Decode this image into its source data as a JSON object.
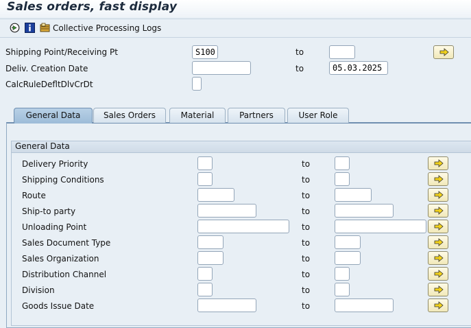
{
  "header": {
    "title": "Sales orders, fast display"
  },
  "toolbar": {
    "execute_icon": "execute-clock-icon",
    "info_icon": "info-icon",
    "logs_icon": "logs-icon",
    "logs_label": "Collective Processing Logs"
  },
  "selection": {
    "to_label": "to",
    "rows": [
      {
        "label": "Shipping Point/Receiving Pt",
        "from": "S100",
        "to": ""
      },
      {
        "label": "Deliv. Creation Date",
        "from": "",
        "to": "05.03.2025"
      },
      {
        "label": "CalcRuleDefltDlvCrDt"
      }
    ]
  },
  "tabs": [
    {
      "label": "General Data",
      "active": true
    },
    {
      "label": "Sales Orders"
    },
    {
      "label": "Material"
    },
    {
      "label": "Partners"
    },
    {
      "label": "User Role"
    }
  ],
  "general": {
    "title": "General Data",
    "rows": [
      {
        "label": "Delivery Priority",
        "from": "",
        "to": ""
      },
      {
        "label": "Shipping Conditions",
        "from": "",
        "to": ""
      },
      {
        "label": "Route",
        "from": "",
        "to": ""
      },
      {
        "label": "Ship-to party",
        "from": "",
        "to": ""
      },
      {
        "label": "Unloading Point",
        "from": "",
        "to": ""
      },
      {
        "label": "Sales Document Type",
        "from": "",
        "to": ""
      },
      {
        "label": "Sales Organization",
        "from": "",
        "to": ""
      },
      {
        "label": "Distribution Channel",
        "from": "",
        "to": ""
      },
      {
        "label": "Division",
        "from": "",
        "to": ""
      },
      {
        "label": "Goods Issue Date",
        "from": "",
        "to": ""
      }
    ]
  },
  "colors": {
    "arrow": "#f2d21b",
    "tab_active": "#9dbcd8",
    "background": "#e8eff5"
  }
}
